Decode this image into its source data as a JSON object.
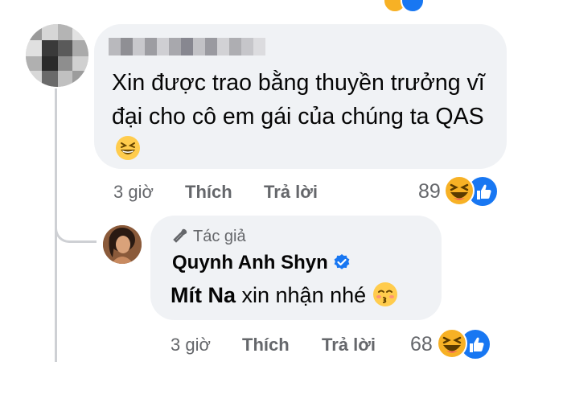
{
  "colors": {
    "bubble": "#f0f2f5",
    "meta_text": "#65676b",
    "like_blue": "#1877f2",
    "haha_yellow": "#f7b125",
    "thread_line": "#ced0d4"
  },
  "top_reactions": [
    "haha-icon",
    "like-icon"
  ],
  "comment1": {
    "author": "",
    "text": "Xin được trao bằng thuyền trưởng vĩ đại cho cô em gái của chúng ta QAS",
    "emoji": "grinning-squint-emoji",
    "time": "3 giờ",
    "like_label": "Thích",
    "reply_label": "Trả lời",
    "reaction_count": "89",
    "reactions": [
      "haha-icon",
      "like-icon"
    ]
  },
  "reply": {
    "badge": "Tác giả",
    "author": "Quynh Anh Shyn",
    "text_bold": "Mít Na",
    "text_rest": " xin nhận nhé",
    "emoji": "kissing-smiling-eyes-emoji",
    "time": "3 giờ",
    "like_label": "Thích",
    "reply_label": "Trả lời",
    "reaction_count": "68",
    "reactions": [
      "haha-icon",
      "like-icon"
    ]
  }
}
